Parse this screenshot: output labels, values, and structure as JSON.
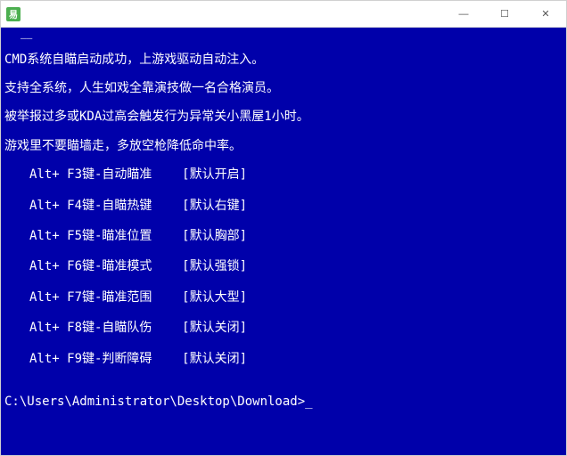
{
  "titlebar": {
    "title": " "
  },
  "controls": {
    "minimize": "—",
    "maximize": "☐",
    "close": "✕"
  },
  "console": {
    "top_marker": "——",
    "intro": [
      "CMD系统自瞄启动成功，上游戏驱动自动注入。",
      "支持全系统，人生如戏全靠演技做一名合格演员。",
      "被举报过多或KDA过高会触发行为异常关小黑屋1小时。",
      "游戏里不要瞄墙走，多放空枪降低命中率。"
    ],
    "binds": [
      {
        "key": "Alt+ F3键-自动瞄准",
        "default": "[默认开启]"
      },
      {
        "key": "Alt+ F4键-自瞄热键",
        "default": "[默认右键]"
      },
      {
        "key": "Alt+ F5键-瞄准位置",
        "default": "[默认胸部]"
      },
      {
        "key": "Alt+ F6键-瞄准模式",
        "default": "[默认强锁]"
      },
      {
        "key": "Alt+ F7键-瞄准范围",
        "default": "[默认大型]"
      },
      {
        "key": "Alt+ F8键-自瞄队伤",
        "default": "[默认关闭]"
      },
      {
        "key": "Alt+ F9键-判断障碍",
        "default": "[默认关闭]"
      }
    ],
    "prompt": "C:\\Users\\Administrator\\Desktop\\Download>"
  }
}
